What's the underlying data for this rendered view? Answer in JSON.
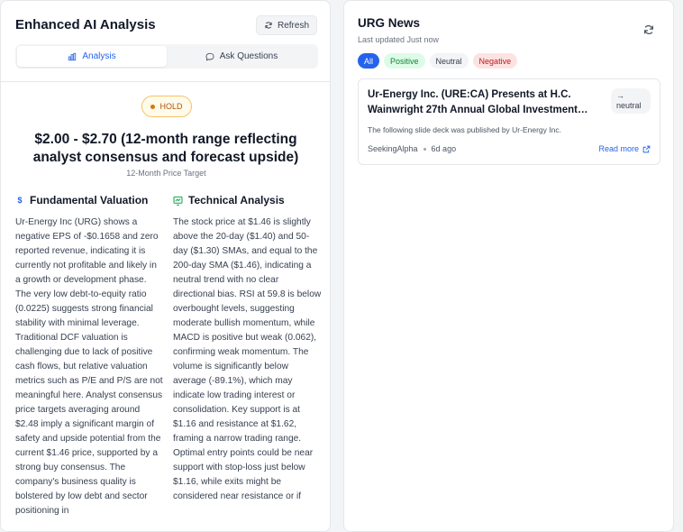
{
  "analysis": {
    "title": "Enhanced AI Analysis",
    "refresh_label": "Refresh",
    "tabs": [
      {
        "label": "Analysis",
        "active": true
      },
      {
        "label": "Ask Questions",
        "active": false
      }
    ],
    "rating": "HOLD",
    "price_target": "$2.00 - $2.70 (12-month range reflecting analyst consensus and forecast upside)",
    "price_target_label": "12-Month Price Target",
    "fundamental": {
      "heading": "Fundamental Valuation",
      "icon": "dollar-icon",
      "text": "Ur-Energy Inc (URG) shows a negative EPS of -$0.1658 and zero reported revenue, indicating it is currently not profitable and likely in a growth or development phase. The very low debt-to-equity ratio (0.0225) suggests strong financial stability with minimal leverage. Traditional DCF valuation is challenging due to lack of positive cash flows, but relative valuation metrics such as P/E and P/S are not meaningful here. Analyst consensus price targets averaging around $2.48 imply a significant margin of safety and upside potential from the current $1.46 price, supported by a strong buy consensus. The company's business quality is bolstered by low debt and sector positioning in"
    },
    "technical": {
      "heading": "Technical Analysis",
      "icon": "chart-icon",
      "text": "The stock price at $1.46 is slightly above the 20-day ($1.40) and 50-day ($1.30) SMAs, and equal to the 200-day SMA ($1.46), indicating a neutral trend with no clear directional bias. RSI at 59.8 is below overbought levels, suggesting moderate bullish momentum, while MACD is positive but weak (0.062), confirming weak momentum. The volume is significantly below average (-89.1%), which may indicate low trading interest or consolidation. Key support is at $1.16 and resistance at $1.62, framing a narrow trading range. Optimal entry points could be near support with stop-loss just below $1.16, while exits might be considered near resistance or if"
    }
  },
  "news": {
    "title": "URG News",
    "updated": "Last updated Just now",
    "filters": [
      "All",
      "Positive",
      "Neutral",
      "Negative"
    ],
    "items": [
      {
        "title": "Ur-Energy Inc. (URE:CA) Presents at H.C. Wainwright 27th Annual Global Investment…",
        "sentiment_arrow": "→",
        "sentiment": "neutral",
        "description": "The following slide deck was published by Ur-Energy Inc.",
        "source": "SeekingAlpha",
        "age": "6d ago",
        "read_more": "Read more"
      }
    ]
  },
  "colors": {
    "accent": "#2563eb",
    "hold": "#d97706",
    "positive": "#15803d",
    "negative": "#b91c1c"
  }
}
